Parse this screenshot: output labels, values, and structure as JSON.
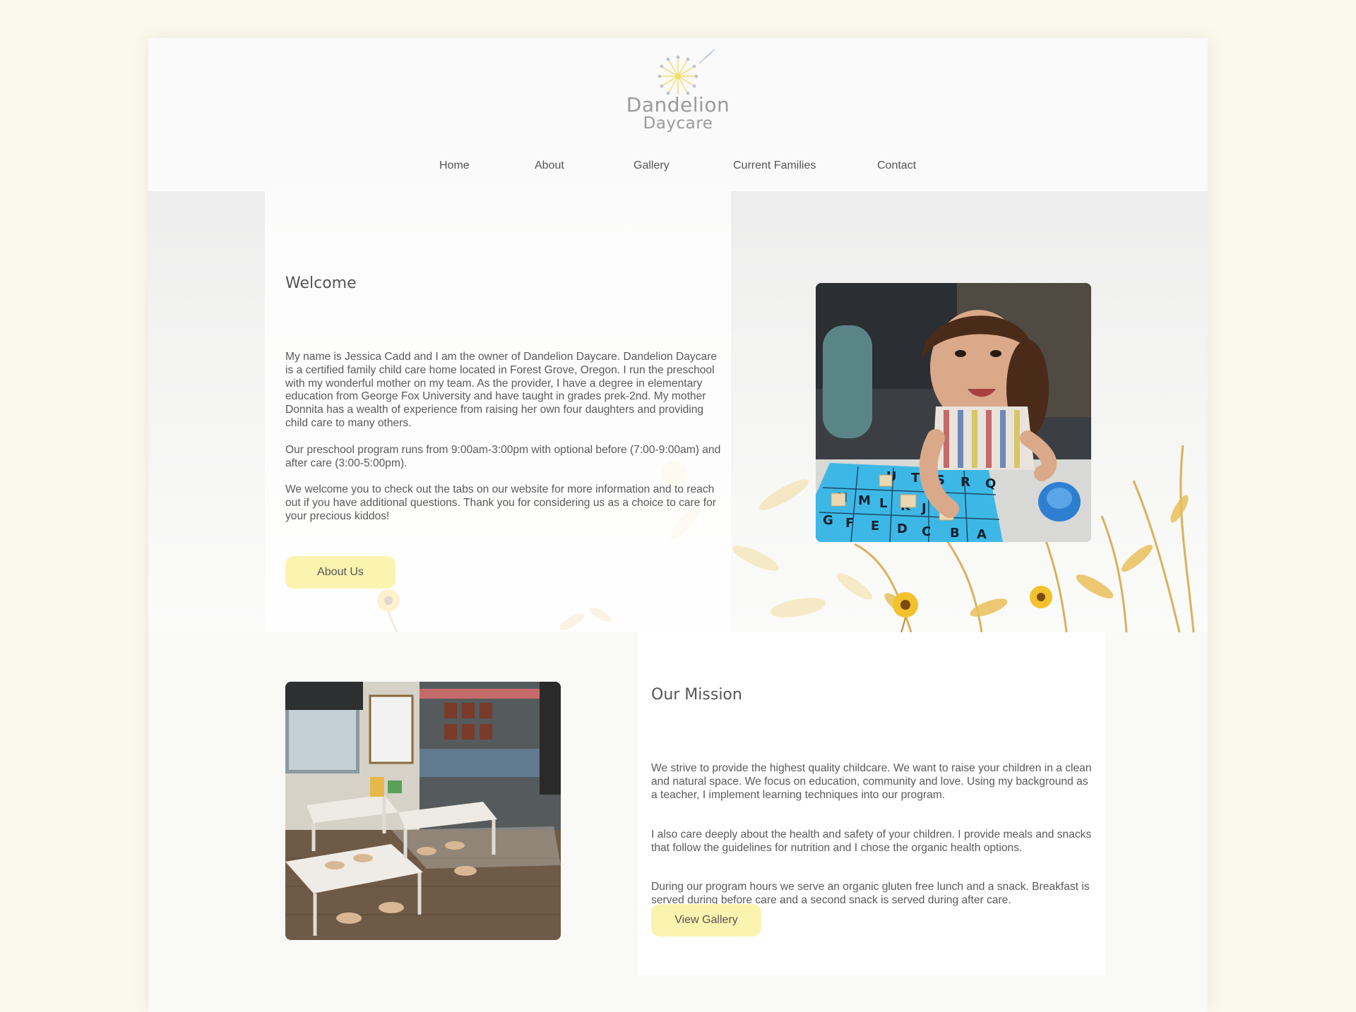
{
  "brand": {
    "line1": "Dandelion",
    "line2": "Daycare"
  },
  "nav": {
    "items": [
      "Home",
      "About",
      "Gallery",
      "Current Families",
      "Contact"
    ]
  },
  "welcome": {
    "title": "Welcome",
    "paragraphs": [
      "My name is Jessica Cadd and I am the owner of Dandelion Daycare. Dandelion Daycare is a certified family child care home located in Forest Grove, Oregon. I run the preschool with my wonderful mother on my team. As the provider, I have a degree in elementary education from George Fox University and have taught in grades prek-2nd. My mother Donnita has a wealth of experience from raising her own four daughters and providing child care to many others.",
      "Our preschool program runs from 9:00am-3:00pm with optional before (7:00-9:00am) and after care (3:00-5:00pm).",
      "We welcome you to check out the tabs on our website for more information and to reach out if you have additional questions. Thank you for considering us as a choice to care for your precious kiddos!"
    ],
    "button": "About Us",
    "board_letters_row1": [
      "A",
      "B",
      "C",
      "D",
      "E",
      "F",
      "G"
    ],
    "board_letters_row2": [
      "J",
      "K",
      "L",
      "M",
      "N"
    ],
    "board_letters_row3": [
      "Q",
      "R",
      "S",
      "T",
      "U"
    ]
  },
  "mission": {
    "title": "Our Mission",
    "paragraphs": [
      "We strive to provide the highest quality childcare. We want to raise your children in a clean and natural space. We focus on education, community and love. Using my background as a teacher, I implement learning techniques into our program.",
      "I also care deeply about the health and safety of your children. I provide meals and snacks that follow the guidelines for nutrition and I chose the organic health options.",
      "During our program hours we serve an organic gluten free lunch and a snack. Breakfast is served during before care and a second snack is served during after care."
    ],
    "button": "View Gallery"
  },
  "colors": {
    "page_bg": "#faf9ec",
    "button_bg": "#fbf3b0",
    "accent_yellow": "#f2c230",
    "text": "#555555"
  }
}
